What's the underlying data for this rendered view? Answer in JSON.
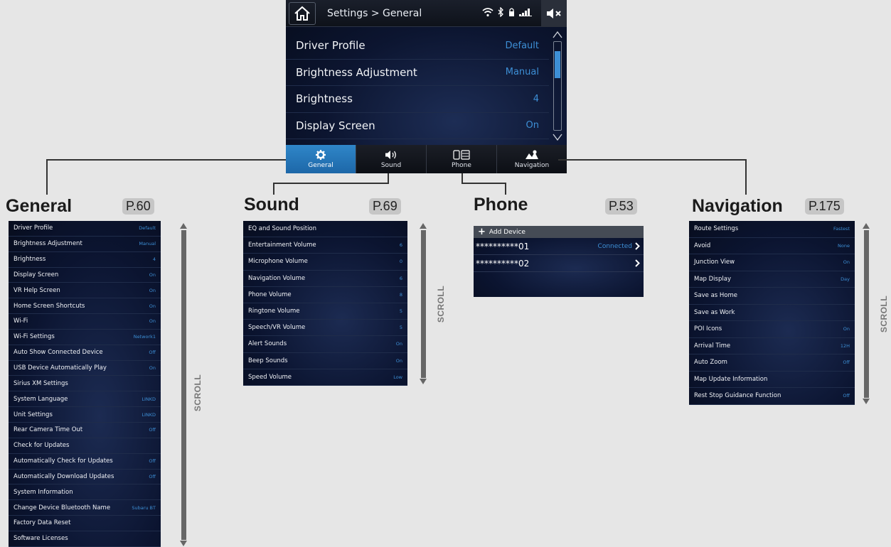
{
  "main": {
    "breadcrumb": "Settings > General",
    "rows": [
      {
        "label": "Driver Profile",
        "value": "Default"
      },
      {
        "label": "Brightness Adjustment",
        "value": "Manual"
      },
      {
        "label": "Brightness",
        "value": "4"
      },
      {
        "label": "Display Screen",
        "value": "On"
      }
    ],
    "tabs": [
      {
        "label": "General",
        "icon": "gear-icon"
      },
      {
        "label": "Sound",
        "icon": "speaker-icon"
      },
      {
        "label": "Phone",
        "icon": "phone-icon"
      },
      {
        "label": "Navigation",
        "icon": "navigation-icon"
      }
    ],
    "scroll_position": 0.15
  },
  "sections": {
    "general": {
      "title": "General",
      "page": "P.60"
    },
    "sound": {
      "title": "Sound",
      "page": "P.69"
    },
    "phone": {
      "title": "Phone",
      "page": "P.53"
    },
    "navigation": {
      "title": "Navigation",
      "page": "P.175"
    }
  },
  "scroll_label": "SCROLL",
  "general_items": [
    {
      "label": "Driver Profile",
      "value": "Default"
    },
    {
      "label": "Brightness Adjustment",
      "value": "Manual"
    },
    {
      "label": "Brightness",
      "value": "4"
    },
    {
      "label": "Display Screen",
      "value": "On"
    },
    {
      "label": "VR Help Screen",
      "value": "On"
    },
    {
      "label": "Home Screen Shortcuts",
      "value": "On"
    },
    {
      "label": "Wi-Fi",
      "value": "On"
    },
    {
      "label": "Wi-Fi Settings",
      "value": "Network1"
    },
    {
      "label": "Auto Show Connected Device",
      "value": "Off"
    },
    {
      "label": "USB Device Automatically Play",
      "value": "On"
    },
    {
      "label": "Sirius XM Settings",
      "value": ""
    },
    {
      "label": "System Language",
      "value": "LINKD"
    },
    {
      "label": "Unit Settings",
      "value": "LINKD"
    },
    {
      "label": "Rear Camera Time Out",
      "value": "Off"
    },
    {
      "label": "Check for Updates",
      "value": ""
    },
    {
      "label": "Automatically Check for Updates",
      "value": "Off"
    },
    {
      "label": "Automatically Download Updates",
      "value": "Off"
    },
    {
      "label": "System Information",
      "value": ""
    },
    {
      "label": "Change Device Bluetooth Name",
      "value": "Subaru BT"
    },
    {
      "label": "Factory Data Reset",
      "value": ""
    },
    {
      "label": "Software Licenses",
      "value": ""
    }
  ],
  "sound_items": [
    {
      "label": "EQ and Sound Position",
      "value": ""
    },
    {
      "label": "Entertainment Volume",
      "value": "6"
    },
    {
      "label": "Microphone Volume",
      "value": "0"
    },
    {
      "label": "Navigation Volume",
      "value": "6"
    },
    {
      "label": "Phone Volume",
      "value": "8"
    },
    {
      "label": "Ringtone Volume",
      "value": "5"
    },
    {
      "label": "Speech/VR Volume",
      "value": "5"
    },
    {
      "label": "Alert Sounds",
      "value": "On"
    },
    {
      "label": "Beep Sounds",
      "value": "On"
    },
    {
      "label": "Speed Volume",
      "value": "Low"
    }
  ],
  "phone": {
    "add_device": "Add Device",
    "devices": [
      {
        "name": "**********01",
        "status": "Connected"
      },
      {
        "name": "**********02",
        "status": ""
      }
    ]
  },
  "navigation_items": [
    {
      "label": "Route Settings",
      "value": "Fastest"
    },
    {
      "label": "Avoid",
      "value": "None"
    },
    {
      "label": "Junction View",
      "value": "On"
    },
    {
      "label": "Map Display",
      "value": "Day"
    },
    {
      "label": "Save as Home",
      "value": ""
    },
    {
      "label": "Save as Work",
      "value": ""
    },
    {
      "label": "POI Icons",
      "value": "On"
    },
    {
      "label": "Arrival Time",
      "value": "12H"
    },
    {
      "label": "Auto Zoom",
      "value": "Off"
    },
    {
      "label": "Map Update Information",
      "value": ""
    },
    {
      "label": "Rest Stop Guidance Function",
      "value": "Off"
    }
  ]
}
